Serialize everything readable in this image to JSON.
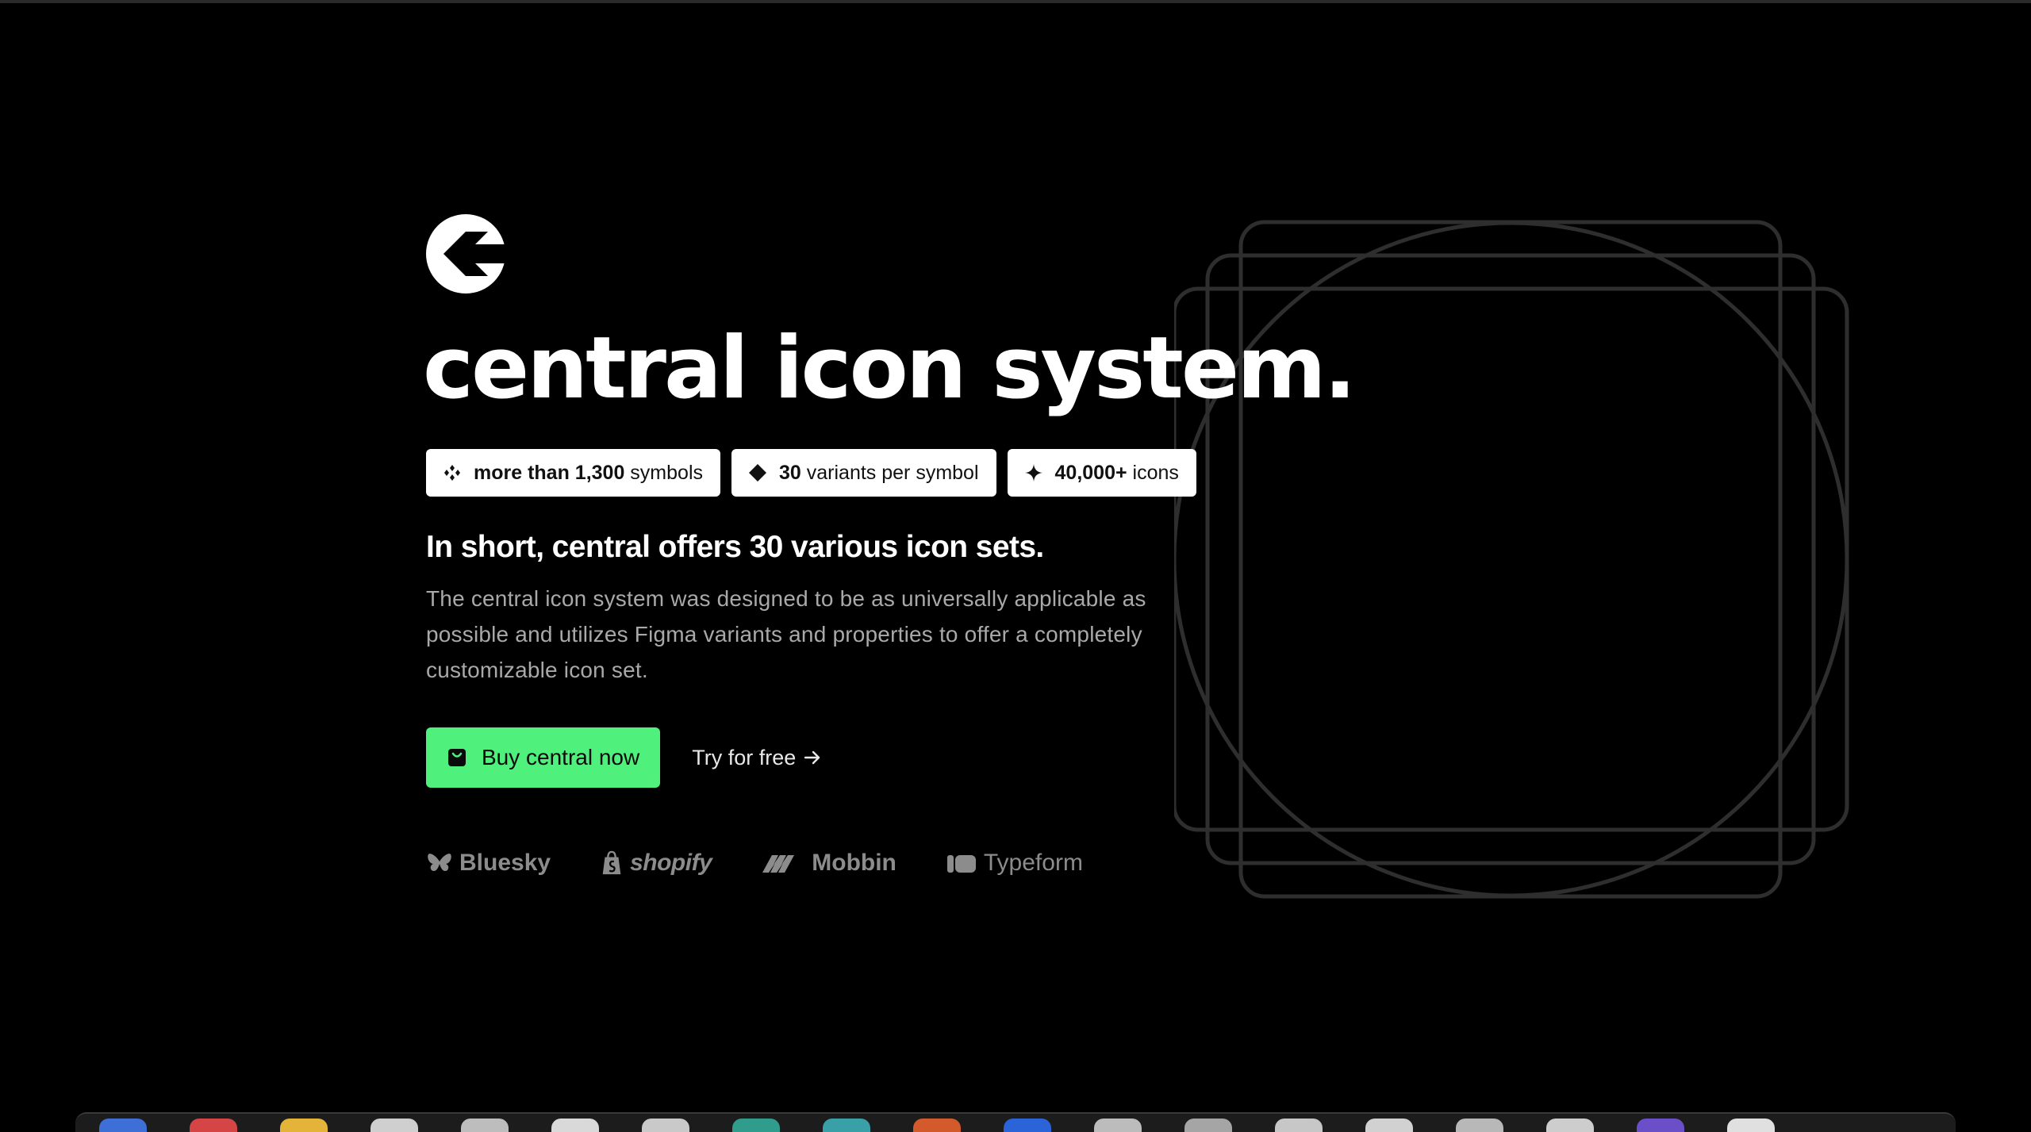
{
  "hero": {
    "title": "central icon system.",
    "badges": [
      {
        "icon": "sparkle-cluster-icon",
        "strong": "more than 1,300",
        "rest": " symbols"
      },
      {
        "icon": "diamond-icon",
        "strong": "30",
        "rest": " variants per symbol"
      },
      {
        "icon": "plus-sparkle-icon",
        "strong": "40,000+",
        "rest": " icons"
      }
    ],
    "subheading": "In short, central offers 30 various icon sets.",
    "description": "The central icon system was designed to be as universally applicable as possible and utilizes Figma variants and properties to offer a completely customizable icon set.",
    "buy_label": "Buy central now",
    "try_label": "Try for free"
  },
  "brands": [
    "Bluesky",
    "shopify",
    "Mobbin",
    "Typeform"
  ],
  "colors": {
    "background": "#000000",
    "accent_green": "#4ff07c",
    "badge_bg": "#ffffff",
    "muted_text": "#a9a9a9",
    "brand_gray": "#8c8c8c",
    "outline_gray": "#2e2e2e"
  }
}
